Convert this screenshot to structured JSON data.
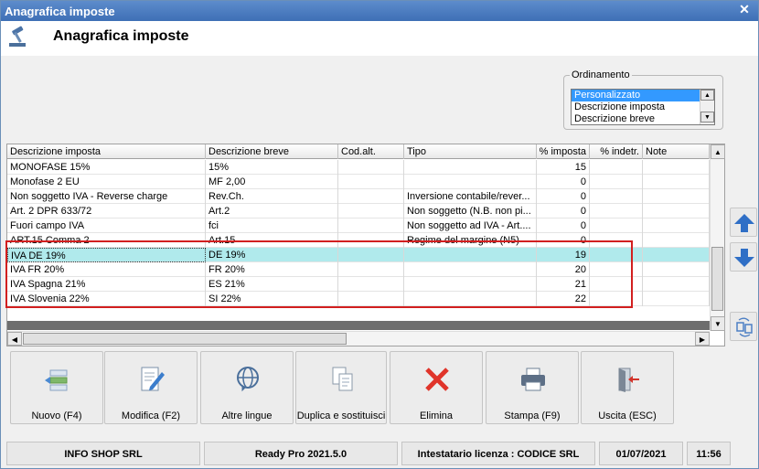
{
  "window": {
    "title": "Anagrafica imposte",
    "close_glyph": "✕"
  },
  "header": {
    "title": "Anagrafica imposte",
    "icon": "gavel-icon"
  },
  "ordinamento": {
    "legend": "Ordinamento",
    "options": [
      "Personalizzato",
      "Descrizione imposta",
      "Descrizione breve"
    ],
    "selected": "Personalizzato"
  },
  "grid": {
    "columns": [
      "Descrizione imposta",
      "Descrizione breve",
      "Cod.alt.",
      "Tipo",
      "% imposta",
      "% indetr.",
      "Note"
    ],
    "rows": [
      [
        "MONOFASE 15%",
        "15%",
        "",
        "",
        "15",
        "",
        ""
      ],
      [
        "Monofase 2 EU",
        "MF 2,00",
        "",
        "",
        "0",
        "",
        ""
      ],
      [
        "Non soggetto IVA - Reverse charge",
        "Rev.Ch.",
        "",
        "Inversione contabile/rever...",
        "0",
        "",
        ""
      ],
      [
        "Art. 2 DPR 633/72",
        "Art.2",
        "",
        "Non soggetto (N.B. non pi...",
        "0",
        "",
        ""
      ],
      [
        "Fuori campo IVA",
        "fci",
        "",
        "Non soggetto ad IVA - Art....",
        "0",
        "",
        ""
      ],
      [
        "ART.15 Comma 2",
        "Art.15",
        "",
        "Regime del margine (N5)",
        "0",
        "",
        ""
      ],
      [
        "IVA DE 19%",
        "DE 19%",
        "",
        "",
        "19",
        "",
        ""
      ],
      [
        "IVA FR 20%",
        "FR 20%",
        "",
        "",
        "20",
        "",
        ""
      ],
      [
        "IVA Spagna 21%",
        "ES 21%",
        "",
        "",
        "21",
        "",
        ""
      ],
      [
        "IVA Slovenia 22%",
        "SI 22%",
        "",
        "",
        "22",
        "",
        ""
      ]
    ],
    "selected_row": 6
  },
  "side": {
    "up_icon": "arrow-up-icon",
    "down_icon": "arrow-down-icon",
    "swap_icon": "swap-icon"
  },
  "toolbar": {
    "buttons": [
      {
        "label": "Nuovo (F4)",
        "icon": "new-icon"
      },
      {
        "label": "Modifica (F2)",
        "icon": "edit-icon"
      },
      {
        "label": "Altre lingue",
        "icon": "globe-icon"
      },
      {
        "label": "Duplica e sostituisci",
        "icon": "duplicate-icon"
      },
      {
        "label": "Elimina",
        "icon": "delete-icon"
      },
      {
        "label": "Stampa (F9)",
        "icon": "print-icon"
      },
      {
        "label": "Uscita (ESC)",
        "icon": "exit-icon"
      }
    ]
  },
  "status": {
    "company": "INFO SHOP SRL",
    "app": "Ready Pro 2021.5.0",
    "license": "Intestatario licenza : CODICE SRL",
    "date": "01/07/2021",
    "time": "11:56"
  },
  "colors": {
    "titlebar": "#4a7cc0",
    "selection": "#b0eaec",
    "highlight_box": "#d21f1f",
    "accent_arrow": "#2f6fc6"
  }
}
